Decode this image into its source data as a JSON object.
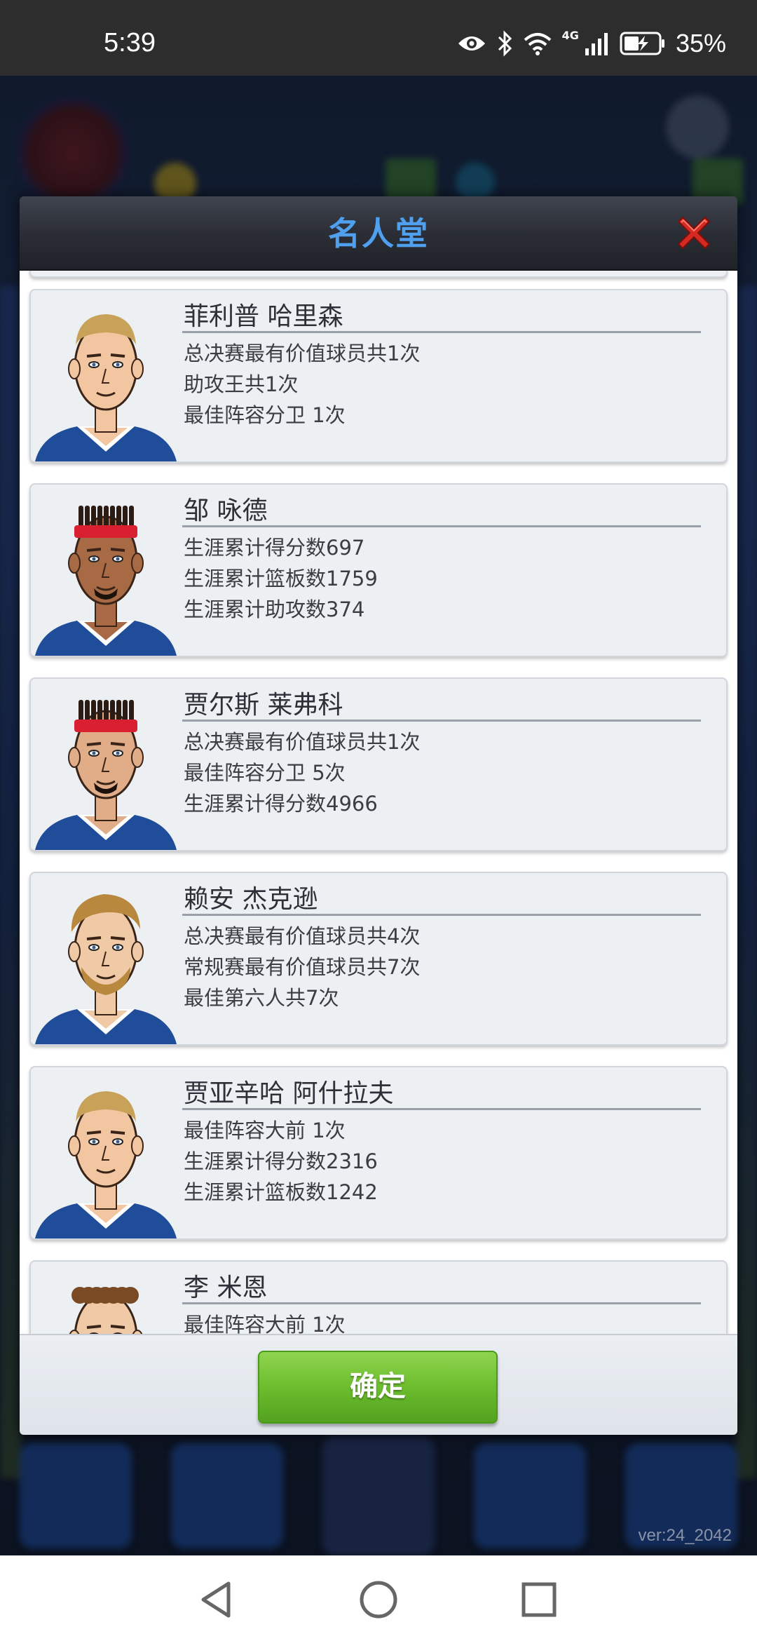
{
  "status_bar": {
    "time": "5:39",
    "network": "4G",
    "battery_percent": "35%",
    "icons": [
      "eye-icon",
      "bluetooth-icon",
      "wifi-icon",
      "signal-icon",
      "battery-charging-icon"
    ]
  },
  "background_app": {
    "version": "ver:24_2042"
  },
  "modal": {
    "title": "名人堂",
    "close_icon": "close-icon",
    "players": [
      {
        "name": "菲利普 哈里森",
        "stats": [
          "总决赛最有价值球员共1次",
          "助攻王共1次",
          "最佳阵容分卫  1次"
        ],
        "hair": "blond-short",
        "avatar_icon": "player-portrait-icon"
      },
      {
        "name": "邹 咏德",
        "stats": [
          "生涯累计得分数697",
          "生涯累计篮板数1759",
          "生涯累计助攻数374"
        ],
        "hair": "braids-headband",
        "avatar_icon": "player-portrait-icon"
      },
      {
        "name": "贾尔斯 莱弗科",
        "stats": [
          "总决赛最有价值球员共1次",
          "最佳阵容分卫  5次",
          "生涯累计得分数4966"
        ],
        "hair": "braids-headband",
        "avatar_icon": "player-portrait-icon"
      },
      {
        "name": "赖安 杰克逊",
        "stats": [
          "总决赛最有价值球员共4次",
          "常规赛最有价值球员共7次",
          "最佳第六人共7次"
        ],
        "hair": "wavy-beard",
        "avatar_icon": "player-portrait-icon"
      },
      {
        "name": "贾亚辛哈 阿什拉夫",
        "stats": [
          "最佳阵容大前  1次",
          "生涯累计得分数2316",
          "生涯累计篮板数1242"
        ],
        "hair": "blond-short",
        "avatar_icon": "player-portrait-icon"
      },
      {
        "name": "李 米恩",
        "stats": [
          "最佳阵容大前  1次"
        ],
        "hair": "curly",
        "avatar_icon": "player-portrait-icon"
      }
    ],
    "confirm_label": "确定"
  },
  "nav_bar": {
    "icons": [
      "back-icon",
      "home-icon",
      "recents-icon"
    ]
  }
}
